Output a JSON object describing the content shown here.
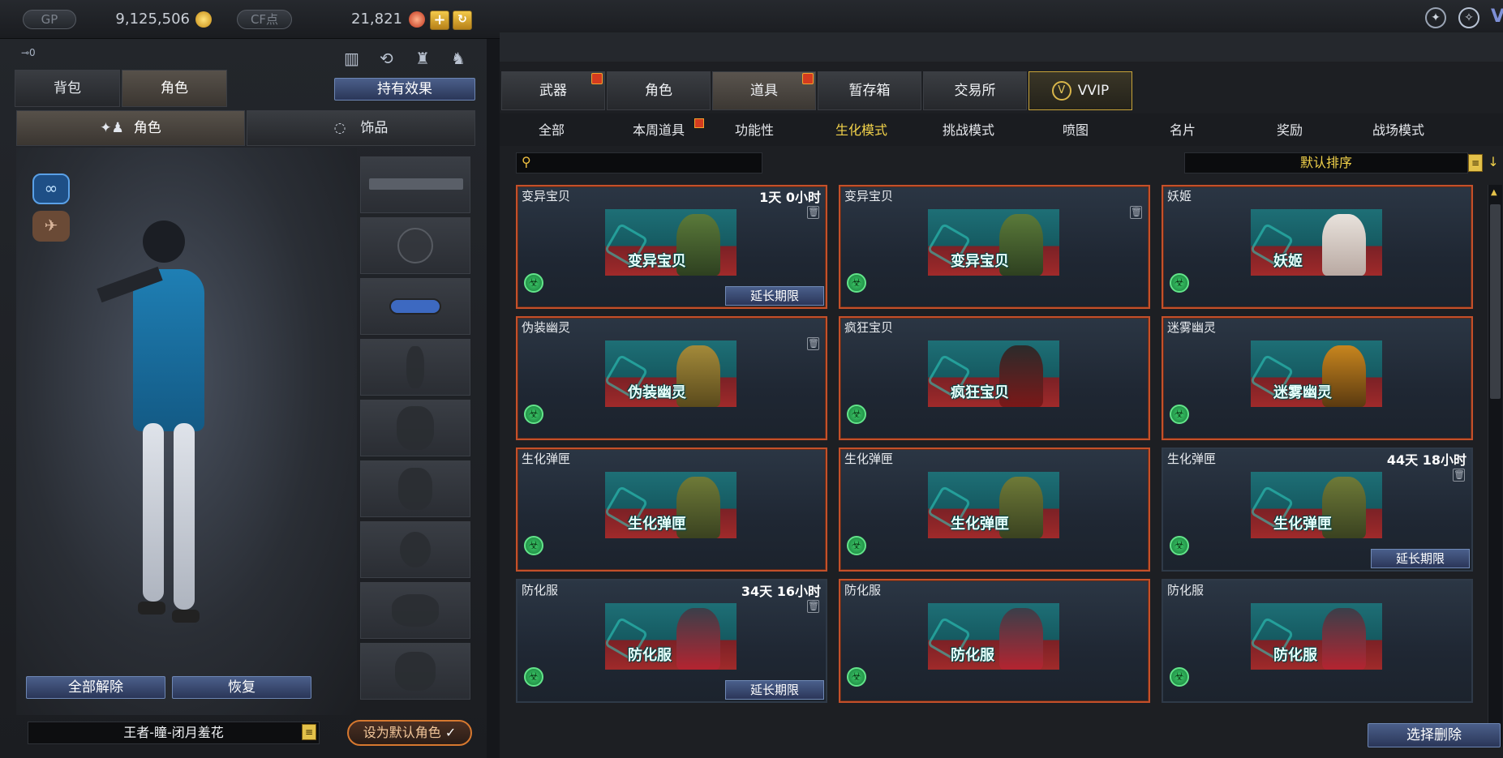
{
  "topbar": {
    "gp_label": "GP",
    "gp_value": "9,125,506",
    "cf_label": "CF点",
    "cf_value": "21,821",
    "plus": "+",
    "key_count": "⊸0",
    "right_icons": [
      "compass-icon",
      "wings-icon",
      "v-icon"
    ]
  },
  "left": {
    "tabs": [
      "背包",
      "角色"
    ],
    "active_tab": "角色",
    "effect_button": "持有效果",
    "subtabs": [
      "角色",
      "饰品"
    ],
    "release_all": "全部解除",
    "restore": "恢复",
    "character_name": "王者-瞳-闭月羞花",
    "set_default": "设为默认角色"
  },
  "shop": {
    "tabs": [
      {
        "label": "武器",
        "gift": true
      },
      {
        "label": "角色",
        "gift": false
      },
      {
        "label": "道具",
        "gift": true
      },
      {
        "label": "暂存箱",
        "gift": false
      },
      {
        "label": "交易所",
        "gift": false
      },
      {
        "label": "VVIP",
        "gift": false
      }
    ],
    "active_tab": "道具",
    "subtabs": [
      "全部",
      "本周道具",
      "功能性",
      "生化模式",
      "挑战模式",
      "喷图",
      "名片",
      "奖励",
      "战场模式"
    ],
    "active_subtab": "生化模式",
    "search_placeholder": "",
    "sort": "默认排序",
    "delete_select": "选择删除",
    "extend_label": "延长期限",
    "items": [
      {
        "name": "变异宝贝",
        "img": "变异宝贝",
        "time": "1天 0小时",
        "trash": true,
        "extend": true,
        "hl": true
      },
      {
        "name": "变异宝贝",
        "img": "变异宝贝",
        "time": "",
        "trash": true,
        "extend": false,
        "hl": true
      },
      {
        "name": "妖姬",
        "img": "妖姬",
        "time": "",
        "trash": false,
        "extend": false,
        "hl": true
      },
      {
        "name": "伪装幽灵",
        "img": "伪装幽灵",
        "time": "",
        "trash": true,
        "extend": false,
        "hl": true
      },
      {
        "name": "疯狂宝贝",
        "img": "疯狂宝贝",
        "time": "",
        "trash": false,
        "extend": false,
        "hl": true
      },
      {
        "name": "迷雾幽灵",
        "img": "迷雾幽灵",
        "time": "",
        "trash": false,
        "extend": false,
        "hl": true
      },
      {
        "name": "生化弹匣",
        "img": "生化弹匣",
        "time": "",
        "trash": false,
        "extend": false,
        "hl": true
      },
      {
        "name": "生化弹匣",
        "img": "生化弹匣",
        "time": "",
        "trash": false,
        "extend": false,
        "hl": true
      },
      {
        "name": "生化弹匣",
        "img": "生化弹匣",
        "time": "44天 18小时",
        "trash": true,
        "extend": true,
        "hl": false
      },
      {
        "name": "防化服",
        "img": "防化服",
        "time": "34天 16小时",
        "trash": true,
        "extend": true,
        "hl": false
      },
      {
        "name": "防化服",
        "img": "防化服",
        "time": "",
        "trash": false,
        "extend": false,
        "hl": true
      },
      {
        "name": "防化服",
        "img": "防化服",
        "time": "",
        "trash": false,
        "extend": false,
        "hl": false
      }
    ]
  }
}
